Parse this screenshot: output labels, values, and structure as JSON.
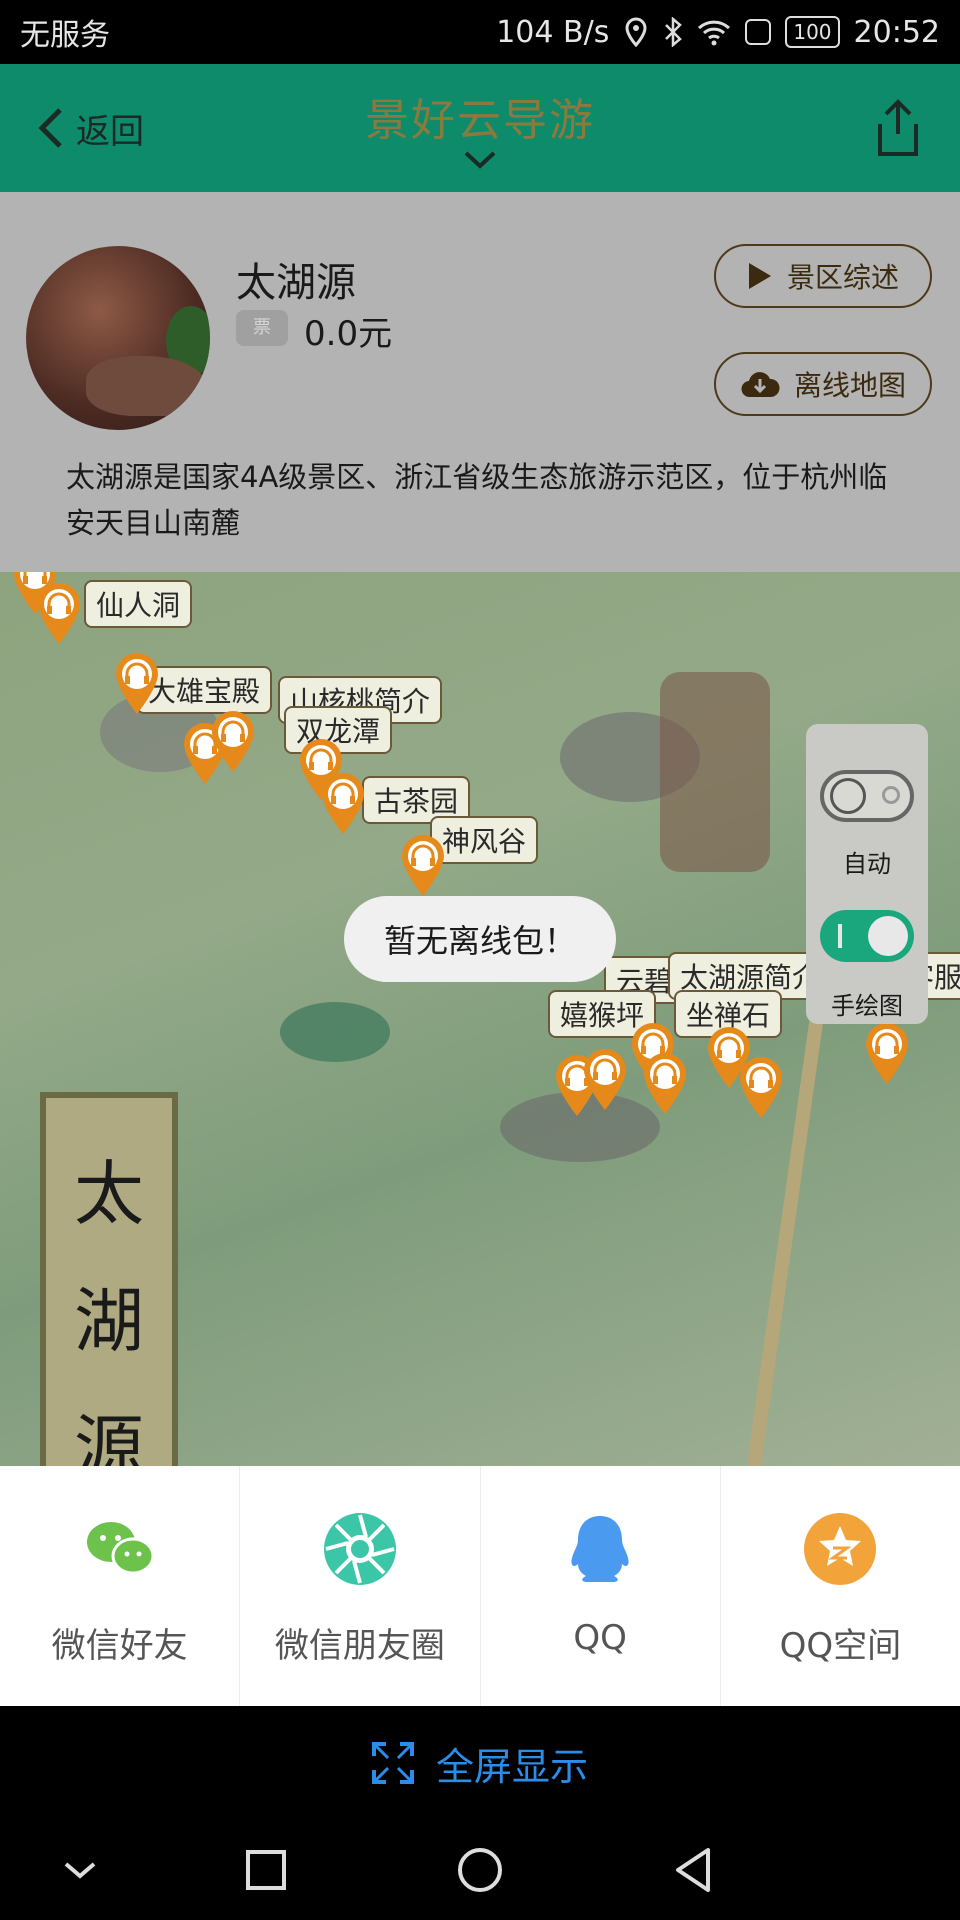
{
  "status_bar": {
    "carrier": "无服务",
    "speed": "104 B/s",
    "battery": "100",
    "time": "20:52"
  },
  "header": {
    "back_label": "返回",
    "title": "景好云导游"
  },
  "spot": {
    "name": "太湖源",
    "ticket_icon_text": "票",
    "price": "0.0元",
    "overview_button": "景区综述",
    "offline_map_button": "离线地图",
    "description": "太湖源是国家4A级景区、浙江省级生态旅游示范区，位于杭州临安天目山南麓"
  },
  "map": {
    "banner_chars": [
      "太",
      "湖",
      "源"
    ],
    "labels": {
      "xianren_dong": "仙人洞",
      "daxiong_baodian": "大雄宝殿",
      "hetao_jianjie": "山核桃简介",
      "shuanglong_tan": "双龙潭",
      "gucha_yuan": "古茶园",
      "shenfeng_gu": "神风谷",
      "taihuyuan_jianjie": "太湖源简介",
      "youke_fuwu": "游客服",
      "yunbi": "云碧",
      "xihou_ping": "嬉猴坪",
      "zuochan_shi": "坐禅石"
    },
    "toast": "暂无离线包！",
    "controls": {
      "auto_label": "自动",
      "hand_drawn_label": "手绘图",
      "auto_on": false,
      "hand_drawn_on": true
    }
  },
  "share": {
    "items": [
      {
        "label": "微信好友",
        "icon": "wechat-icon",
        "color": "#6cc24a"
      },
      {
        "label": "微信朋友圈",
        "icon": "moments-icon",
        "color": "#3cc6a8"
      },
      {
        "label": "QQ",
        "icon": "qq-icon",
        "color": "#4a9bf0"
      },
      {
        "label": "QQ空间",
        "icon": "qzone-icon",
        "color": "#f2a33a"
      }
    ]
  },
  "fullscreen_label": "全屏显示",
  "colors": {
    "header_green": "#0e8b6b",
    "accent_blue": "#2b8de8",
    "pin_orange": "#e58a1a"
  }
}
